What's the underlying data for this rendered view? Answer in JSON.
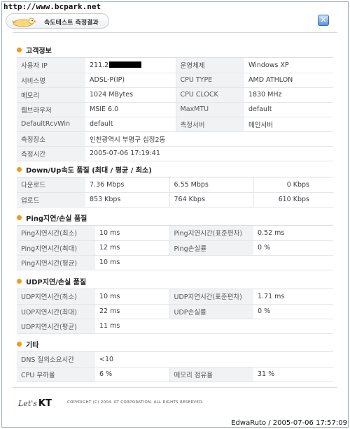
{
  "url_stamp": "http://www.bcpark.net",
  "header": {
    "title": "속도테스트 측정결과",
    "close_label": "✕"
  },
  "sections": {
    "customer": {
      "title": "고객정보",
      "rows": [
        {
          "k1": "사용자 IP",
          "v1": "211.2",
          "k2": "운영체제",
          "v2": "Windows XP"
        },
        {
          "k1": "서비스명",
          "v1": "ADSL-P(IP)",
          "k2": "CPU TYPE",
          "v2": "AMD ATHLON"
        },
        {
          "k1": "메모리",
          "v1": "1024 MBytes",
          "k2": "CPU CLOCK",
          "v2": "1830 MHz"
        },
        {
          "k1": "웹브라우저",
          "v1": "MSIE 6.0",
          "k2": "MaxMTU",
          "v2": "default"
        },
        {
          "k1": "DefaultRcvWin",
          "v1": "default",
          "k2": "측정서버",
          "v2": "메인서버"
        }
      ],
      "location_label": "측정장소",
      "location_value": "인천광역시 부평구 십정2동",
      "time_label": "측정시간",
      "time_value": "2005-07-06 17:19:41"
    },
    "speed": {
      "title": "Down/Up속도 품질 (최대 / 평균 / 최소)",
      "rows": [
        {
          "label": "다운로드",
          "max": "7.36 Mbps",
          "avg": "6.55 Mbps",
          "min": "0 Kbps"
        },
        {
          "label": "업로드",
          "max": "853 Kbps",
          "avg": "764 Kbps",
          "min": "610 Kbps"
        }
      ]
    },
    "ping": {
      "title": "Ping지연/손실 품질",
      "rows": [
        {
          "k1": "Ping지연시간(최소)",
          "v1": "10 ms",
          "k2": "Ping지연시간(표준편차)",
          "v2": "0.52 ms"
        },
        {
          "k1": "Ping지연시간(최대)",
          "v1": "12 ms",
          "k2": "Ping손실률",
          "v2": "0 %"
        }
      ],
      "avg_label": "Ping지연시간(평균)",
      "avg_value": "10 ms"
    },
    "udp": {
      "title": "UDP지연/손실 품질",
      "rows": [
        {
          "k1": "UDP지연시간(최소)",
          "v1": "10 ms",
          "k2": "UDP지연시간(표준편차)",
          "v2": "1.71 ms"
        },
        {
          "k1": "UDP지연시간(최대)",
          "v1": "22 ms",
          "k2": "UDP손실률",
          "v2": "0 %"
        }
      ],
      "avg_label": "UDP지연시간(평균)",
      "avg_value": "11 ms"
    },
    "etc": {
      "title": "기타",
      "dns_label": "DNS 질의소요시간",
      "dns_value": "<10",
      "cpu_label": "CPU 부하율",
      "cpu_value": "6 %",
      "mem_label": "메모리 점유율",
      "mem_value": "31 %"
    }
  },
  "footer": {
    "lets": "Let's",
    "kt": "KT",
    "copyright": "COPYRIGHT (C) 2004. KT CORPORATION. ALL RIGHTS RESERVED."
  },
  "watermark": "EdwaRuto / 2005-07-06 17:57:09",
  "colors": {
    "bullet": "#f29a18",
    "close_button": "#5b93d8",
    "label_bg": "#f1f2f4"
  }
}
